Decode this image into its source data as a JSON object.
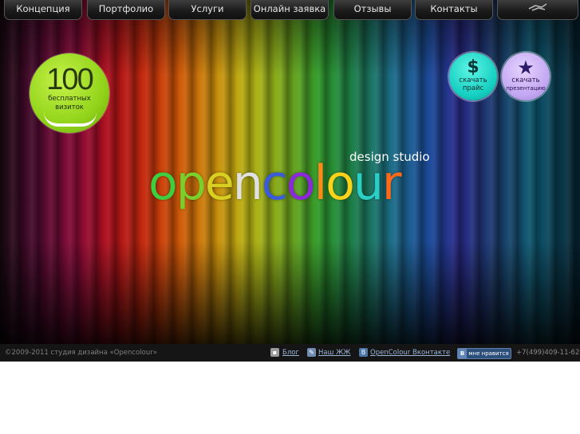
{
  "nav": {
    "items": [
      {
        "label": "Концепция"
      },
      {
        "label": "Портфолио"
      },
      {
        "label": "Услуги"
      },
      {
        "label": "Онлайн заявка"
      },
      {
        "label": "Отзывы"
      },
      {
        "label": "Контакты"
      }
    ],
    "last_icon": "tools-icon"
  },
  "promo": {
    "number": "100",
    "line1": "бесплатных",
    "line2": "визиток"
  },
  "downloads": {
    "price": {
      "icon": "dollar-icon",
      "glyph": "$",
      "line1": "скачать",
      "line2": "прайс"
    },
    "presentation": {
      "icon": "star-icon",
      "glyph": "★",
      "line1": "скачать",
      "line2": "презентацию"
    }
  },
  "logo": {
    "subtitle": "design studio",
    "letters": [
      {
        "ch": "o",
        "color": "#3ecf3e"
      },
      {
        "ch": "p",
        "color": "#7ccf2a"
      },
      {
        "ch": "e",
        "color": "#d8d020"
      },
      {
        "ch": "n",
        "color": "#e0e0e0"
      },
      {
        "ch": "c",
        "color": "#3a5cd8"
      },
      {
        "ch": "o",
        "color": "#8a2ad8"
      },
      {
        "ch": "l",
        "color": "#ff8a1a"
      },
      {
        "ch": "o",
        "color": "#ffd21a"
      },
      {
        "ch": "u",
        "color": "#2ad0c8"
      },
      {
        "ch": "r",
        "color": "#ff6a1a"
      }
    ]
  },
  "footer": {
    "copyright": "©2009-2011 студия дизайна «Opencolour»",
    "links": [
      {
        "label": "Блог",
        "icon": "chat-icon"
      },
      {
        "label": "Наш ЖЖ",
        "icon": "livejournal-icon"
      },
      {
        "label": "OpenColour Вконтакте",
        "icon": "vk-icon"
      }
    ],
    "like_label": "мне нравится",
    "like_icon": "В",
    "phone": "+7(499)409-11-62"
  },
  "colors": {
    "accent_green": "#92d41a",
    "price_cyan": "#14cfc0",
    "presentation_lilac": "#c2a6f2",
    "footer_bg": "#151515"
  }
}
